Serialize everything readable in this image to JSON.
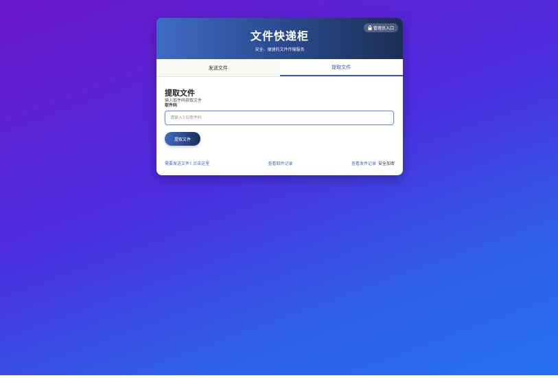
{
  "header": {
    "title": "文件快递柜",
    "subtitle": "安全、便捷的文件传输服务",
    "admin_label": "管理员入口",
    "admin_icon": "lock-icon"
  },
  "tabs": [
    {
      "label": "发送文件",
      "active": false
    },
    {
      "label": "提取文件",
      "active": true
    }
  ],
  "panel": {
    "title": "提取文件",
    "description": "输入取件码获取文件",
    "field_label": "取件码",
    "input_placeholder": "请输入5位取件码",
    "input_value": "",
    "submit_label": "提取文件"
  },
  "footer": {
    "send_link": "需要发送文件? 点击这里",
    "pickup_records": "查看取件记录",
    "send_records": "查看发件记录",
    "secure_text": "安全加密"
  },
  "colors": {
    "accent": "#3a55b8",
    "header_start": "#3f6bc4",
    "header_end": "#1c2e55"
  }
}
